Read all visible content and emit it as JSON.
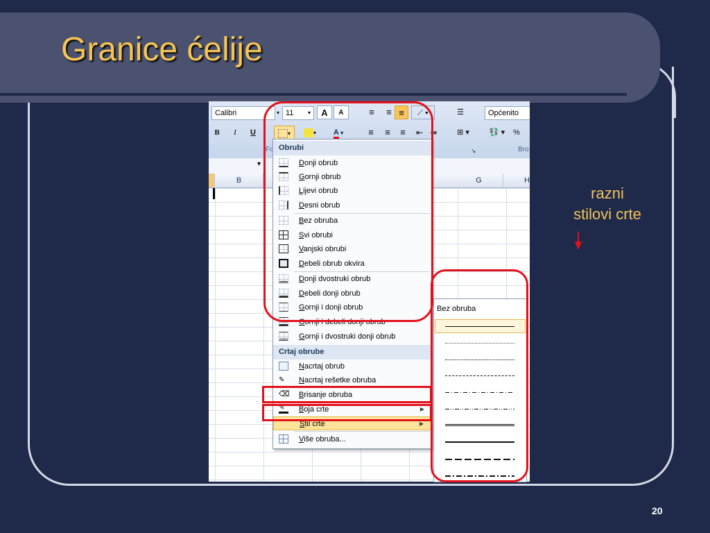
{
  "slide": {
    "title": "Granice ćelije",
    "page_number": "20",
    "note_line1": "razni",
    "note_line2": "stilovi crte"
  },
  "ribbon": {
    "font_name": "Calibri",
    "font_size": "11",
    "bold_label": "B",
    "italic_label": "I",
    "underline_label": "U",
    "grow_font": "A",
    "shrink_font": "A",
    "font_color_label": "A",
    "number_format": "Općenito",
    "percent_label": "%",
    "font_group_label": "Fo",
    "number_group_label": "Bro"
  },
  "columns": [
    "B",
    "G",
    "H"
  ],
  "menu": {
    "header_borders": "Obrubi",
    "border_items": [
      {
        "label": "Donji obrub",
        "icon": "bottom-border-icon"
      },
      {
        "label": "Gornji obrub",
        "icon": "top-border-icon"
      },
      {
        "label": "Lijevi obrub",
        "icon": "left-border-icon"
      },
      {
        "label": "Desni obrub",
        "icon": "right-border-icon"
      },
      {
        "label": "Bez obruba",
        "icon": "no-border-icon"
      },
      {
        "label": "Svi obrubi",
        "icon": "all-borders-icon"
      },
      {
        "label": "Vanjski obrubi",
        "icon": "outside-borders-icon"
      },
      {
        "label": "Debeli obrub okvira",
        "icon": "thick-box-border-icon"
      },
      {
        "label": "Donji dvostruki obrub",
        "icon": "bottom-double-border-icon"
      },
      {
        "label": "Debeli donji obrub",
        "icon": "thick-bottom-border-icon"
      },
      {
        "label": "Gornji i donji obrub",
        "icon": "top-bottom-border-icon"
      },
      {
        "label": "Gornji i debeli donji obrub",
        "icon": "top-thick-bottom-border-icon"
      },
      {
        "label": "Gornji i dvostruki donji obrub",
        "icon": "top-double-bottom-border-icon"
      }
    ],
    "header_draw": "Crtaj obrube",
    "draw_items": [
      {
        "label": "Nacrtaj obrub",
        "icon": "draw-border-icon"
      },
      {
        "label": "Nacrtaj rešetke obruba",
        "icon": "draw-border-grid-icon"
      },
      {
        "label": "Brisanje obruba",
        "icon": "erase-border-icon"
      },
      {
        "label": "Boja crte",
        "icon": "line-color-icon"
      },
      {
        "label": "Stil crte",
        "icon": "line-style-icon"
      },
      {
        "label": "Više obruba...",
        "icon": "more-borders-icon"
      }
    ]
  },
  "line_style_submenu": {
    "none_label": "Bez obruba",
    "styles": [
      "thin",
      "hair",
      "dotted",
      "dashed",
      "dash-dot",
      "dash-dot-dot",
      "double",
      "medium",
      "medium-dashed",
      "medium-dash-dot"
    ]
  },
  "colors": {
    "background": "#1f2a4a",
    "title": "#f6c454",
    "highlight_red": "#e3101c",
    "menu_hover": "#fde49a"
  }
}
